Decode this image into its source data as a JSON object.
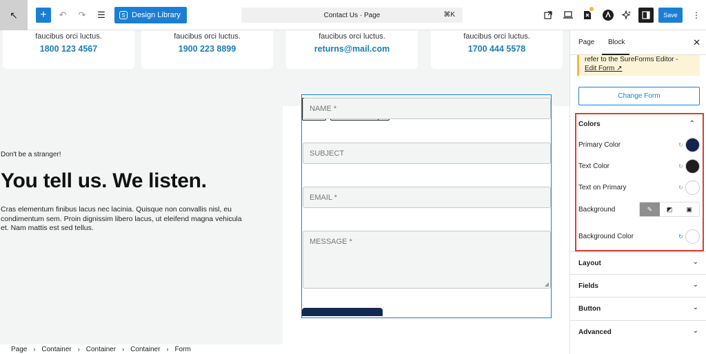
{
  "toolbar": {
    "back_icon": "↖",
    "add_icon": "+",
    "undo_icon": "↶",
    "redo_icon": "↷",
    "list_icon": "☰",
    "design_library_label": "Design Library",
    "document_title": "Contact Us · Page",
    "shortcut": "⌘K",
    "save_label": "Save",
    "more_icon": "⋮"
  },
  "contact_cards": [
    {
      "text": "faucibus orci luctus.",
      "value": "1800 123 4567"
    },
    {
      "text": "faucibus orci luctus.",
      "value": "1900 223 8899"
    },
    {
      "text": "faucibus orci luctus.",
      "value": "returns@mail.com"
    },
    {
      "text": "faucibus orci luctus.",
      "value": "1700 444 5578"
    }
  ],
  "hero": {
    "tagline": "Don't be a stranger!",
    "headline": "You tell us. We listen.",
    "paragraph": "Cras elementum finibus lacus nec lacinia. Quisque non convallis nisl, eu condimentum sem. Proin dignissim libero lacus, ut eleifend magna vehicula et. Nam mattis est sed tellus."
  },
  "form": {
    "name_placeholder": "NAME *",
    "subject_placeholder": "SUBJECT",
    "email_placeholder": "EMAIL *",
    "message_placeholder": "MESSAGE *"
  },
  "breadcrumb": [
    "Page",
    "Container",
    "Container",
    "Container",
    "Form"
  ],
  "sidebar": {
    "tab_page": "Page",
    "tab_block": "Block",
    "notice_text": "refer to the SureForms Editor -",
    "notice_link": "Edit Form ↗",
    "change_form_label": "Change Form",
    "colors_title": "Colors",
    "colors": [
      {
        "label": "Primary Color",
        "value": "#14234b"
      },
      {
        "label": "Text Color",
        "value": "#1e1e1e"
      },
      {
        "label": "Text on Primary",
        "value": "#ffffff"
      }
    ],
    "background_label": "Background",
    "background_color_label": "Background Color",
    "background_color_value": "#ffffff",
    "panels": [
      "Layout",
      "Fields",
      "Button",
      "Advanced"
    ]
  },
  "accent_color": "#1a7fd4",
  "highlight_color": "#e23b2b"
}
